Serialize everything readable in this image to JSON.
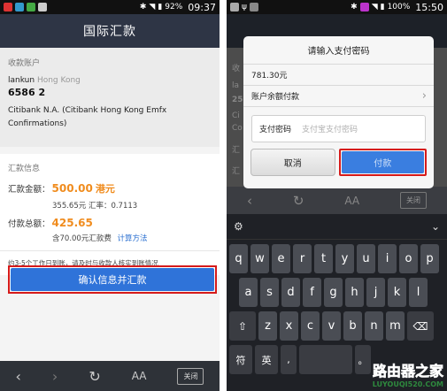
{
  "left": {
    "status": {
      "battery": "92%",
      "time": "09:37"
    },
    "title": "国际汇款",
    "payee": {
      "section_label": "收款账户",
      "name": "lankun",
      "region": "Hong Kong",
      "account_no": "6586 2",
      "bank": "Citibank N.A. (Citibank Hong Kong Emfx Confirmations)"
    },
    "remit": {
      "section_label": "汇款信息",
      "amount_label": "汇款金额：",
      "amount_value": "500.00",
      "amount_unit": "港元",
      "rate_line": "355.65元  汇率：0.7113",
      "total_label": "付款总额：",
      "total_value": "425.65",
      "fee_line": "含70.00元汇款费",
      "fee_link": "计算方法"
    },
    "note": "约3-5个工作日到账，请及时与收款人核实到账情况",
    "confirm_button": "确认信息并汇款",
    "browser": {
      "back": "‹",
      "forward": "›",
      "refresh": "↻",
      "font": "AA",
      "close": "关闭"
    }
  },
  "right": {
    "status": {
      "battery": "100%",
      "time": "15:50"
    },
    "background_labels": [
      "收",
      "la",
      "25",
      "Ci",
      "Co",
      "汇",
      "汇"
    ],
    "dialog": {
      "title": "请输入支付密码",
      "amount": "781.30元",
      "pay_method": "账户余额付款",
      "pw_label": "支付密码",
      "pw_placeholder": "支付宝支付密码",
      "cancel": "取消",
      "pay": "付款"
    },
    "browser": {
      "back": "‹",
      "refresh": "↻",
      "font": "AA",
      "close": "关闭"
    },
    "keyboard": {
      "row1": [
        "q",
        "w",
        "e",
        "r",
        "t",
        "y",
        "u",
        "i",
        "o",
        "p"
      ],
      "row2": [
        "a",
        "s",
        "d",
        "f",
        "g",
        "h",
        "j",
        "k",
        "l"
      ],
      "row3": [
        "z",
        "x",
        "c",
        "v",
        "b",
        "n",
        "m"
      ],
      "bottom": [
        "符",
        "英",
        ",",
        "。"
      ]
    },
    "watermark": {
      "line1": "路由器之家",
      "line2": "LUYOUQI520.COM"
    }
  }
}
